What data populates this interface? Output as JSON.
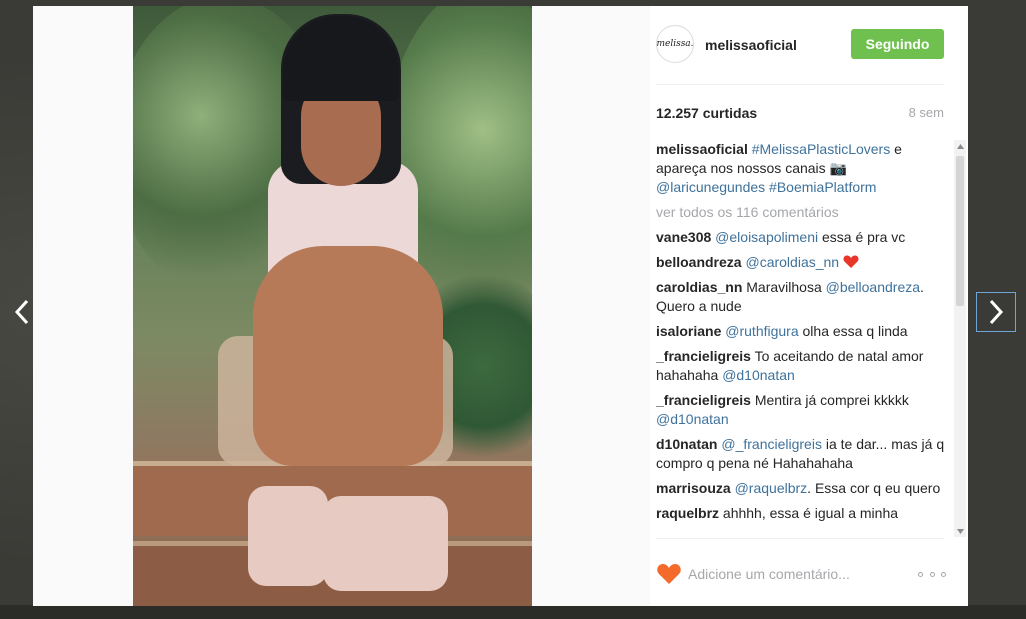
{
  "post": {
    "username": "melissaoficial",
    "avatar_text": "melissa.",
    "follow_label": "Seguindo",
    "likes": "12.257 curtidas",
    "time": "8 sem"
  },
  "caption": {
    "user": "melissaoficial",
    "hashtag": "#MelissaPlasticLovers",
    "text": " e apareça nos nossos canais 📷 ",
    "mention": "@laricunegundes",
    "hashtag2": " #BoemiaPlatform"
  },
  "view_all": "ver todos os 116 comentários",
  "comments": [
    {
      "user": "vane308",
      "mention": "@eloisapolimeni",
      "text": " essa é pra vc"
    },
    {
      "user": "belloandreza",
      "mention": "@caroldias_nn",
      "text": " "
    },
    {
      "user": "caroldias_nn",
      "text": " Maravilhosa ",
      "mention": "@belloandreza",
      "text2": ". Quero a nude"
    },
    {
      "user": "isaloriane",
      "mention": "@ruthfigura",
      "text": " olha essa q linda"
    },
    {
      "user": "_francieligreis",
      "text": " To aceitando de natal amor hahahaha ",
      "mention": "@d10natan"
    },
    {
      "user": "_francieligreis",
      "text": " Mentira já comprei kkkkk ",
      "mention": "@d10natan"
    },
    {
      "user": "d10natan",
      "mention": "@_francieligreis",
      "text": " ia te dar... mas já q compro q pena né Hahahahaha"
    },
    {
      "user": "marrisouza",
      "mention": "@raquelbrz",
      "text": ". Essa cor q eu quero"
    },
    {
      "user": "raquelbrz",
      "text": " ahhhh, essa é igual a minha"
    }
  ],
  "footer": {
    "comment_placeholder": "Adicione um comentário..."
  },
  "colors": {
    "follow_green": "#70c050",
    "link_blue": "#3f729b",
    "like_heart": "#f46a2a"
  }
}
